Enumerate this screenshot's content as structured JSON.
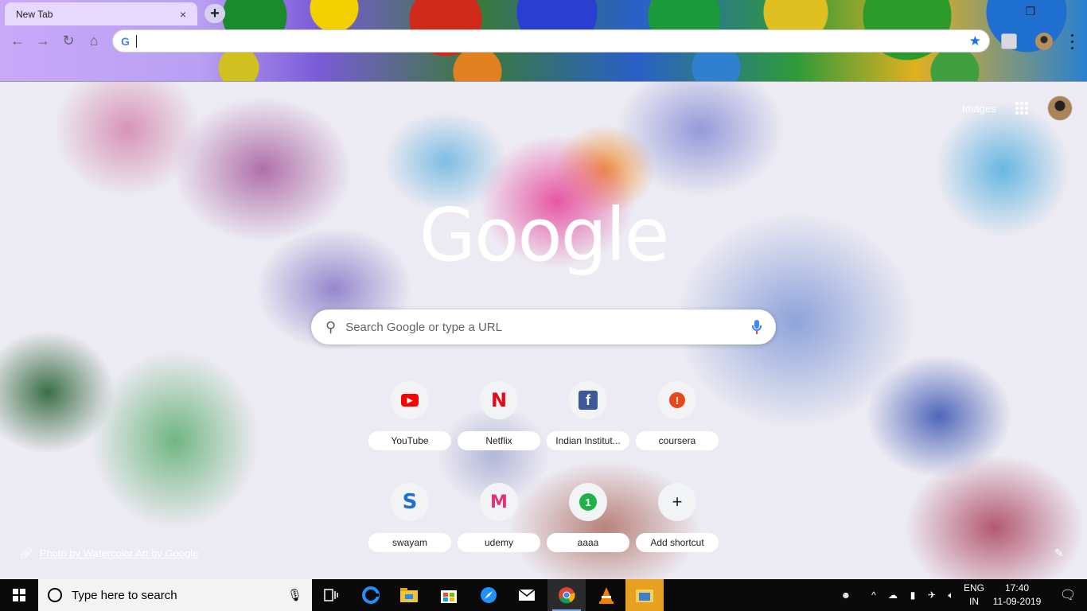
{
  "browser": {
    "tab_title": "New Tab",
    "tab_close": "×",
    "new_tab": "+",
    "omnibox_value": "",
    "omnibox_icon": "google-g-icon",
    "bookmark_icon": "star-icon",
    "nav": {
      "back": "←",
      "forward": "→",
      "reload": "↻",
      "home": "⌂"
    },
    "accent_color": "#1a73e8"
  },
  "ntp": {
    "top_link": "Images",
    "logo_text": "Google",
    "search_placeholder": "Search Google or type a URL",
    "shortcuts": [
      {
        "label": "YouTube",
        "icon": "youtube-icon",
        "glyph": "▶"
      },
      {
        "label": "Netflix",
        "icon": "netflix-icon",
        "glyph": "N"
      },
      {
        "label": "Indian Institut...",
        "icon": "facebook-icon",
        "glyph": "f"
      },
      {
        "label": "coursera",
        "icon": "coursera-icon",
        "glyph": "!"
      },
      {
        "label": "swayam",
        "icon": "swayam-icon",
        "glyph": "S"
      },
      {
        "label": "udemy",
        "icon": "udemy-icon",
        "glyph": "M"
      },
      {
        "label": "aaaa",
        "icon": "aaaa-icon",
        "glyph": "1"
      },
      {
        "label": "Add shortcut",
        "icon": "plus-icon",
        "glyph": "+"
      }
    ],
    "photo_credit": "Photo by Watercolor Art by Google"
  },
  "taskbar": {
    "search_placeholder": "Type here to search",
    "lang_line1": "ENG",
    "lang_line2": "IN",
    "time": "17:40",
    "date": "11-09-2019"
  }
}
